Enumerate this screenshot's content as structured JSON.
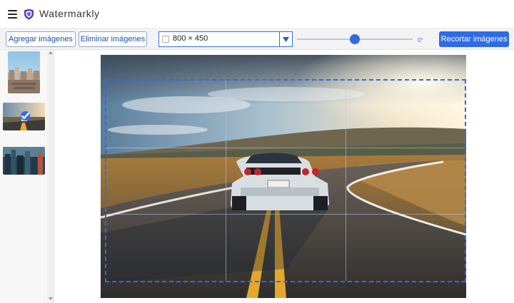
{
  "app": {
    "title": "Watermarkly",
    "menu_icon": "hamburger-menu-icon",
    "logo_icon": "shield-logo-icon"
  },
  "toolbar": {
    "add_label": "Agregar imágenes",
    "remove_label": "Eliminar imágenes",
    "size_select": {
      "value": "800 × 450"
    },
    "rotation": {
      "value": 0,
      "min": -45,
      "max": 45,
      "label": "0°"
    },
    "crop_label": "Recortar imágenes"
  },
  "sidebar": {
    "thumbnails": [
      {
        "name": "thumbnail-city",
        "selected": false
      },
      {
        "name": "thumbnail-road-car",
        "selected": true
      },
      {
        "name": "thumbnail-skyline",
        "selected": false
      }
    ]
  },
  "colors": {
    "accent": "#2e6be6",
    "crop_border": "#3b66e0"
  }
}
